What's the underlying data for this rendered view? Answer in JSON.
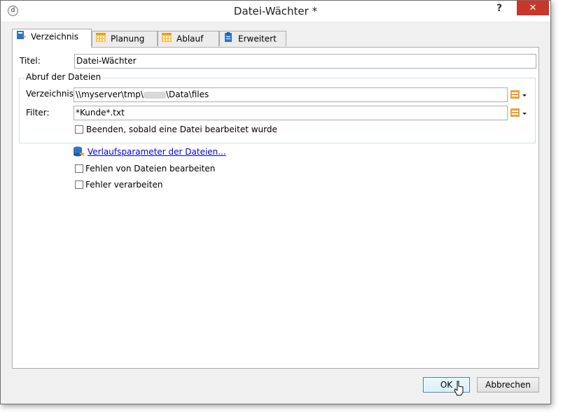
{
  "window": {
    "title": "Datei-Wächter *",
    "help_glyph": "?",
    "close_glyph": "✕"
  },
  "tabs": [
    {
      "label": "Verzeichnis",
      "icon": "folder-down-icon",
      "active": true
    },
    {
      "label": "Planung",
      "icon": "calendar-icon",
      "active": false
    },
    {
      "label": "Ablauf",
      "icon": "calendar-icon",
      "active": false
    },
    {
      "label": "Erweitert",
      "icon": "clipboard-icon",
      "active": false
    }
  ],
  "form": {
    "title_label": "Titel:",
    "title_value": "Datei-Wächter",
    "group_title": "Abruf der Dateien",
    "dir_label": "Verzeichnis:",
    "dir_value_prefix": "\\\\myserver\\tmp\\",
    "dir_value_suffix": "\\Data\\files",
    "filter_label": "Filter:",
    "filter_value": "*Kunde*.txt",
    "stop_checkbox_label": "Beenden, sobald eine Datei bearbeitet wurde",
    "history_link": "Verlaufsparameter der Dateien...",
    "missing_checkbox_label": "Fehlen von Dateien bearbeiten",
    "error_checkbox_label": "Fehler verarbeiten"
  },
  "footer": {
    "ok_label": "OK",
    "cancel_label": "Abbrechen"
  },
  "colors": {
    "close": "#c7372b",
    "link": "#0000ee",
    "icon_orange": "#f0a030",
    "icon_blue": "#2e75c8"
  }
}
